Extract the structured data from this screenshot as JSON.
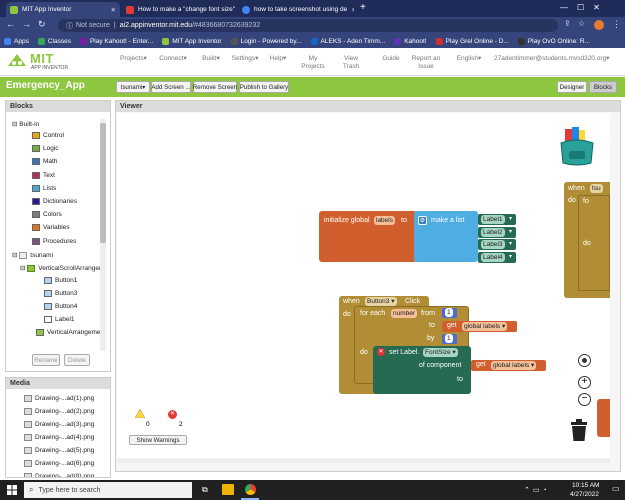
{
  "browser": {
    "tabs": [
      {
        "title": "MIT App Inventor",
        "color": "#8dc63f"
      },
      {
        "title": "How to make a \"change font size\"",
        "color": "#e53935"
      },
      {
        "title": "how to take screenshot using de",
        "color": "#4285f4"
      }
    ],
    "new_tab_glyph": "+",
    "security_label": "Not secure",
    "url_host": "ai2.appinventor.mit.edu",
    "url_rest": "/#4836680732639232",
    "bookmarks": [
      {
        "label": "Apps",
        "color": "#4285f4"
      },
      {
        "label": "Classes",
        "color": "#34a853"
      },
      {
        "label": "Play Kahoot! - Enter...",
        "color": "#7b1fa2"
      },
      {
        "label": "MIT App Inventor",
        "color": "#8dc63f"
      },
      {
        "label": "Login - Powered by...",
        "color": "#555"
      },
      {
        "label": "ALEKS - Aden Timm...",
        "color": "#1565c0"
      },
      {
        "label": "Kahoot!",
        "color": "#5e35b1"
      },
      {
        "label": "Play Grel Online - D...",
        "color": "#d32f2f"
      },
      {
        "label": "Play OvO Online: R...",
        "color": "#333"
      }
    ]
  },
  "ai_header": {
    "logo_top": "MIT",
    "logo_bottom": "APP INVENTOR",
    "menus": [
      "Projects",
      "Connect",
      "Build",
      "Settings",
      "Help",
      "My Projects",
      "View Trash",
      "Guide",
      "Report an Issue",
      "English",
      "27adentimmer@students.mvsd320.org"
    ],
    "menu_suffixes": [
      "▾",
      "▾",
      "▾",
      "▾",
      "▾",
      "",
      "",
      "",
      "",
      "▾",
      "▾"
    ]
  },
  "titlebar": {
    "project_name": "Emergency_App",
    "screen_select": "tsunami",
    "buttons": [
      "Add Screen ...",
      "Remove Screen",
      "Publish to Gallery"
    ],
    "designer": "Designer",
    "blocks": "Blocks"
  },
  "blocks_panel": {
    "heading": "Blocks",
    "builtin": "Built-in",
    "categories": [
      {
        "label": "Control",
        "color": "#e1a91a"
      },
      {
        "label": "Logic",
        "color": "#77ab41"
      },
      {
        "label": "Math",
        "color": "#3f71b5"
      },
      {
        "label": "Text",
        "color": "#b32d5e"
      },
      {
        "label": "Lists",
        "color": "#49a6d4"
      },
      {
        "label": "Dictionaries",
        "color": "#2d1799"
      },
      {
        "label": "Colors",
        "color": "#7d7d7d"
      },
      {
        "label": "Variables",
        "color": "#e07420"
      },
      {
        "label": "Procedures",
        "color": "#7c5385"
      }
    ],
    "screen": "tsunami",
    "arrangement": "VerticalScrollArrangen",
    "components": [
      "Button1",
      "Button3",
      "Button4",
      "Label1",
      "VerticalArrangemer"
    ],
    "rename": "Rename",
    "delete": "Delete"
  },
  "media_panel": {
    "heading": "Media",
    "files": [
      "Drawing-...ad(1).png",
      "Drawing-...ad(2).png",
      "Drawing-...ad(3).png",
      "Drawing-...ad(4).png",
      "Drawing-...ad(5).png",
      "Drawing-...ad(6).png",
      "Drawing-...ad(8).png"
    ]
  },
  "viewer": {
    "heading": "Viewer",
    "init_block": {
      "init": "initialize global",
      "name": "labels",
      "to": "to",
      "make_list": "make a list",
      "items": [
        "Label1",
        "Label2",
        "Label3",
        "Label4"
      ]
    },
    "when_block": {
      "when": "when",
      "component": "Button3",
      "event": "Click",
      "do": "do"
    },
    "for_block": {
      "for_each": "for each",
      "var": "number",
      "from": "from",
      "from_val": "1",
      "to": "to",
      "get": "get",
      "get_name": "global labels",
      "by": "by",
      "by_val": "1",
      "do": "do"
    },
    "set_block": {
      "set": "set Label.",
      "prop": "FontSize",
      "of_component": "of component",
      "get": "get",
      "get_name": "global labels",
      "to": "to"
    },
    "partial": {
      "when": "when",
      "comp": "tsu",
      "do": "do",
      "for": "fo",
      "do2": "do"
    },
    "warnings": "0",
    "errors": "2",
    "show_warnings": "Show Warnings"
  },
  "taskbar": {
    "search_placeholder": "Type here to search",
    "time": "10:15 AM",
    "date": "4/27/2022"
  },
  "colors": {
    "ai_green": "#8dc63f",
    "control_block": "#b18e35",
    "variable_block": "#d05f2d",
    "list_block": "#4eaee2",
    "component_block": "#276a52",
    "math_block": "#4a6cd4"
  }
}
